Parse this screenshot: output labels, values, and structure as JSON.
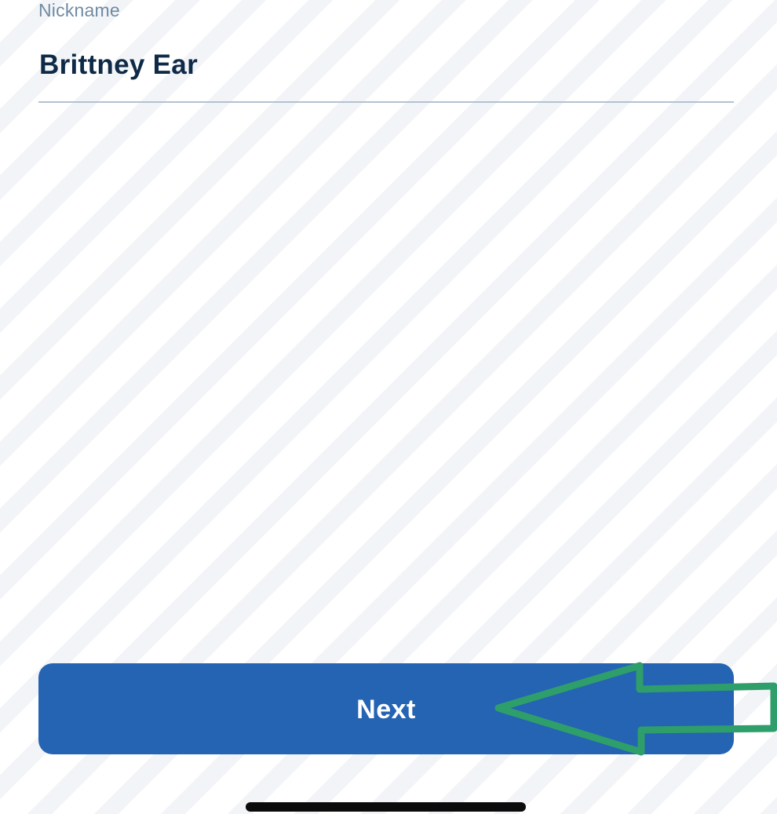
{
  "form": {
    "nickname": {
      "label": "Nickname",
      "value": "Brittney Ear"
    }
  },
  "actions": {
    "next_label": "Next"
  },
  "colors": {
    "primary_button": "#2563b3",
    "annotation_arrow": "#2e9e6b",
    "label_text": "#6f8aa3",
    "value_text": "#0e2a47"
  },
  "icons": {
    "annotation": "green-arrow-outline-pointing-left"
  }
}
